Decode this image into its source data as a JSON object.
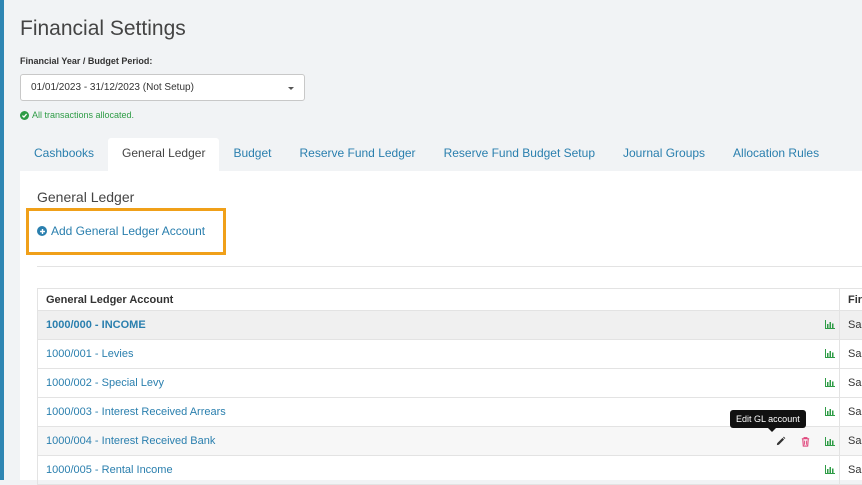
{
  "page": {
    "title": "Financial Settings"
  },
  "financial_year": {
    "label": "Financial Year / Budget Period:",
    "selected": "01/01/2023 - 31/12/2023 (Not Setup)"
  },
  "allocation_status": {
    "text": "All transactions allocated.",
    "color": "#2e9c46"
  },
  "tabs": [
    {
      "label": "Cashbooks",
      "active": false
    },
    {
      "label": "General Ledger",
      "active": true
    },
    {
      "label": "Budget",
      "active": false
    },
    {
      "label": "Reserve Fund Ledger",
      "active": false
    },
    {
      "label": "Reserve Fund Budget Setup",
      "active": false
    },
    {
      "label": "Journal Groups",
      "active": false
    },
    {
      "label": "Allocation Rules",
      "active": false
    }
  ],
  "general_ledger": {
    "title": "General Ledger",
    "add_button_label": "Add General Ledger Account",
    "table": {
      "columns": [
        "General Ledger Account",
        "Fir"
      ],
      "rows": [
        {
          "account": "1000/000 - INCOME",
          "fin": "Sal",
          "group": true
        },
        {
          "account": "1000/001 - Levies",
          "fin": "Sal",
          "group": false
        },
        {
          "account": "1000/002 - Special Levy",
          "fin": "Sal",
          "group": false
        },
        {
          "account": "1000/003 - Interest Received Arrears",
          "fin": "Sal",
          "group": false
        },
        {
          "account": "1000/004 - Interest Received Bank",
          "fin": "Sal",
          "group": false
        },
        {
          "account": "1000/005 - Rental Income",
          "fin": "Sal",
          "group": false
        }
      ]
    },
    "tooltip": "Edit GL account"
  },
  "colors": {
    "accent": "#2a7fae",
    "highlight": "#f0a019",
    "chart_icon": "#2e9c46",
    "delete_icon": "#e0457b"
  }
}
